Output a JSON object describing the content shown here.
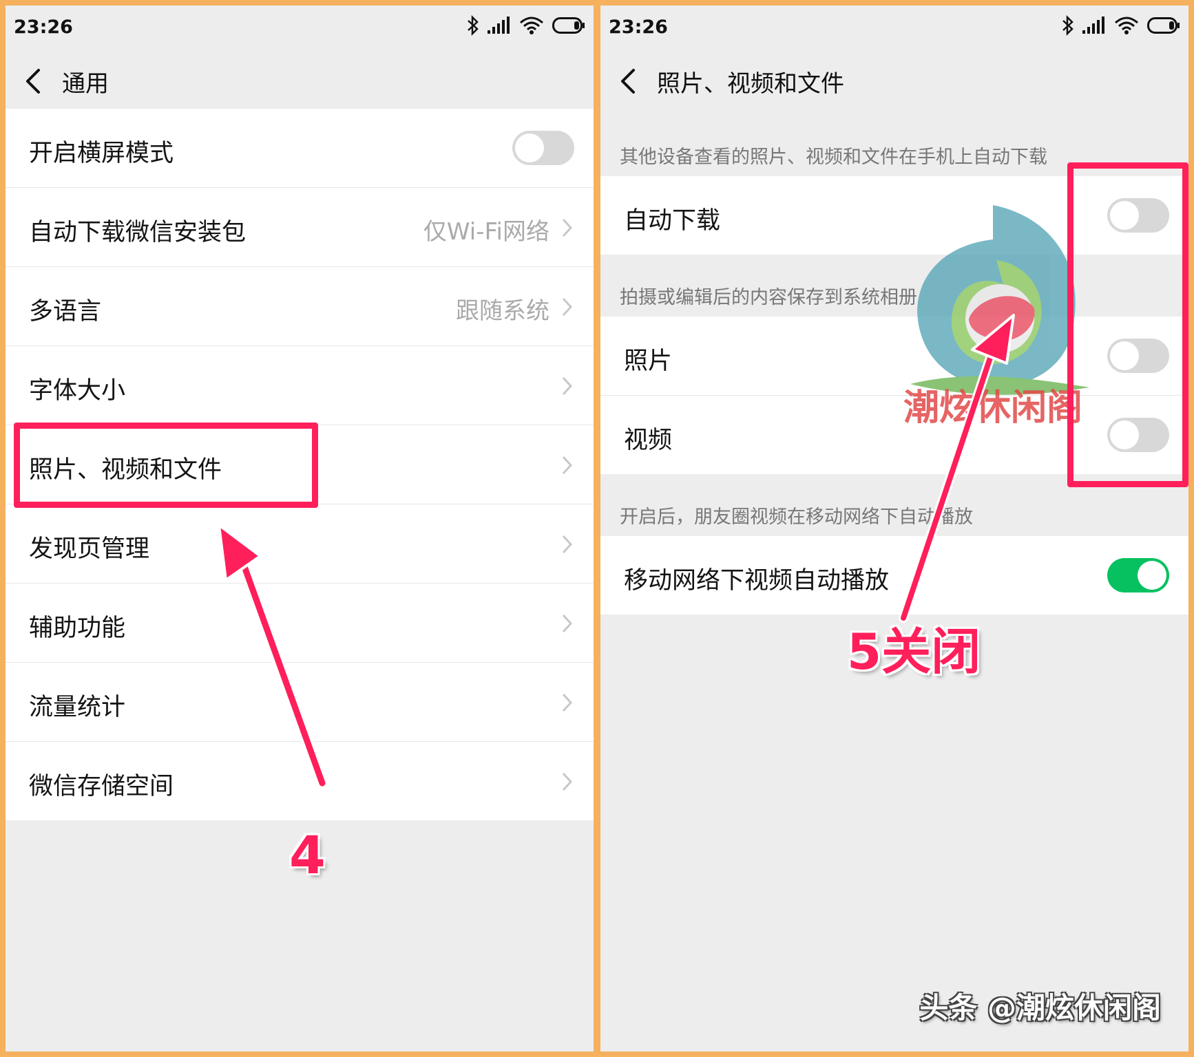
{
  "left": {
    "status": {
      "time": "23:26"
    },
    "title": "通用",
    "rows": [
      {
        "label": "开启横屏模式",
        "value": ""
      },
      {
        "label": "自动下载微信安装包",
        "value": "仅Wi-Fi网络"
      },
      {
        "label": "多语言",
        "value": "跟随系统"
      },
      {
        "label": "字体大小",
        "value": ""
      },
      {
        "label": "照片、视频和文件",
        "value": ""
      },
      {
        "label": "发现页管理",
        "value": ""
      },
      {
        "label": "辅助功能",
        "value": ""
      },
      {
        "label": "流量统计",
        "value": ""
      },
      {
        "label": "微信存储空间",
        "value": ""
      }
    ],
    "toggle_landscape_on": false,
    "annotation_number": "4"
  },
  "right": {
    "status": {
      "time": "23:26"
    },
    "title": "照片、视频和文件",
    "sections": [
      {
        "header": "其他设备查看的照片、视频和文件在手机上自动下载",
        "rows": [
          {
            "label": "自动下载",
            "on": false
          }
        ]
      },
      {
        "header": "拍摄或编辑后的内容保存到系统相册",
        "rows": [
          {
            "label": "照片",
            "on": false
          },
          {
            "label": "视频",
            "on": false
          }
        ]
      },
      {
        "header": "开启后，朋友圈视频在移动网络下自动播放",
        "rows": [
          {
            "label": "移动网络下视频自动播放",
            "on": true
          }
        ]
      }
    ],
    "annotation_text": "5关闭"
  },
  "watermark": {
    "logo_text": "潮炫休闲阁",
    "footer": "头条 @潮炫休闲阁"
  },
  "colors": {
    "accent_annotation": "#ff1f5b",
    "toggle_on": "#07c160",
    "border": "#f5b15e"
  }
}
